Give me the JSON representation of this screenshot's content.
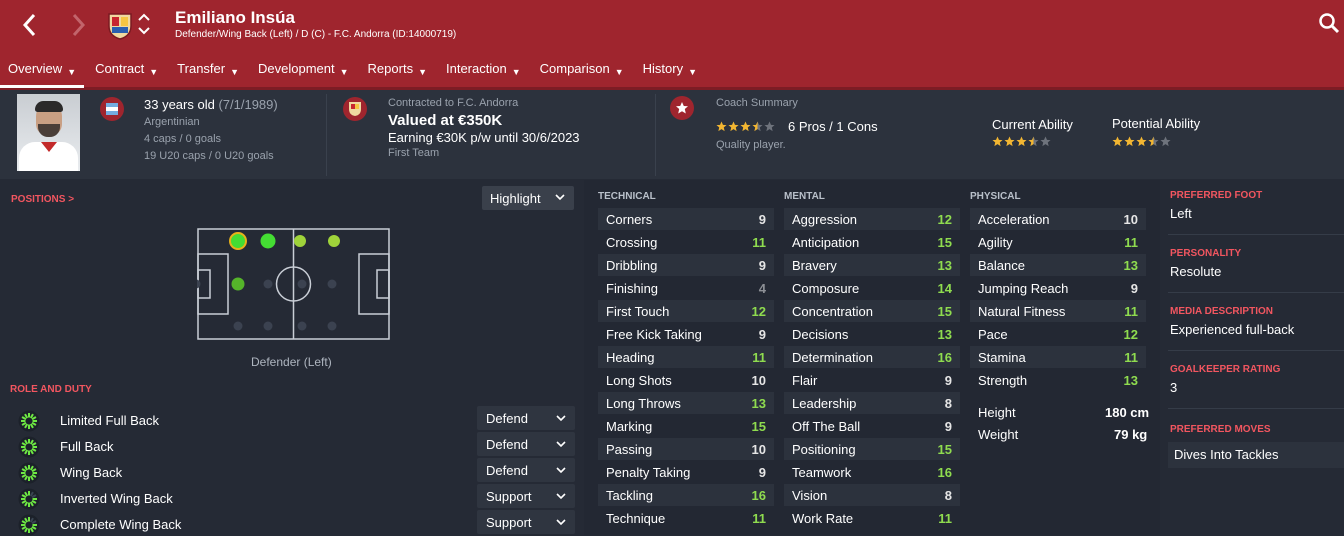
{
  "player": {
    "name": "Emiliano Insúa",
    "subtitle": "Defender/Wing Back (Left) / D (C) - F.C. Andorra (ID:14000719)"
  },
  "tabs": [
    {
      "label": "Overview"
    },
    {
      "label": "Contract"
    },
    {
      "label": "Transfer"
    },
    {
      "label": "Development"
    },
    {
      "label": "Reports"
    },
    {
      "label": "Interaction"
    },
    {
      "label": "Comparison"
    },
    {
      "label": "History"
    }
  ],
  "bio": {
    "age": "33 years old",
    "dob": "(7/1/1989)",
    "nationality": "Argentinian",
    "caps": "4 caps / 0 goals",
    "u20_caps": "19 U20 caps / 0 U20 goals"
  },
  "contract": {
    "contracted_to": "Contracted to F.C. Andorra",
    "value": "Valued at €350K",
    "earning": "Earning €30K p/w until 30/6/2023",
    "squad": "First Team"
  },
  "coach": {
    "title": "Coach Summary",
    "pros_cons": "6 Pros / 1 Cons",
    "stars": 3.5,
    "summary": "Quality player.",
    "current_ability_label": "Current Ability",
    "current_ability_stars": 3.5,
    "potential_ability_label": "Potential Ability",
    "potential_ability_stars": 3.5
  },
  "positions": {
    "title": "POSITIONS",
    "arrow": ">",
    "highlight_label": "Highlight",
    "position_label": "Defender (Left)"
  },
  "role_and_duty": {
    "title": "ROLE AND DUTY",
    "roles": [
      {
        "name": "Limited Full Back",
        "duty": "Defend"
      },
      {
        "name": "Full Back",
        "duty": "Defend"
      },
      {
        "name": "Wing Back",
        "duty": "Defend"
      },
      {
        "name": "Inverted Wing Back",
        "duty": "Support"
      },
      {
        "name": "Complete Wing Back",
        "duty": "Support"
      }
    ]
  },
  "technical": {
    "title": "TECHNICAL",
    "attrs": [
      {
        "name": "Corners",
        "value": "9"
      },
      {
        "name": "Crossing",
        "value": "11"
      },
      {
        "name": "Dribbling",
        "value": "9"
      },
      {
        "name": "Finishing",
        "value": "4"
      },
      {
        "name": "First Touch",
        "value": "12"
      },
      {
        "name": "Free Kick Taking",
        "value": "9"
      },
      {
        "name": "Heading",
        "value": "11"
      },
      {
        "name": "Long Shots",
        "value": "10"
      },
      {
        "name": "Long Throws",
        "value": "13"
      },
      {
        "name": "Marking",
        "value": "15"
      },
      {
        "name": "Passing",
        "value": "10"
      },
      {
        "name": "Penalty Taking",
        "value": "9"
      },
      {
        "name": "Tackling",
        "value": "16"
      },
      {
        "name": "Technique",
        "value": "11"
      }
    ]
  },
  "mental": {
    "title": "MENTAL",
    "attrs": [
      {
        "name": "Aggression",
        "value": "12"
      },
      {
        "name": "Anticipation",
        "value": "15"
      },
      {
        "name": "Bravery",
        "value": "13"
      },
      {
        "name": "Composure",
        "value": "14"
      },
      {
        "name": "Concentration",
        "value": "15"
      },
      {
        "name": "Decisions",
        "value": "13"
      },
      {
        "name": "Determination",
        "value": "16"
      },
      {
        "name": "Flair",
        "value": "9"
      },
      {
        "name": "Leadership",
        "value": "8"
      },
      {
        "name": "Off The Ball",
        "value": "9"
      },
      {
        "name": "Positioning",
        "value": "15"
      },
      {
        "name": "Teamwork",
        "value": "16"
      },
      {
        "name": "Vision",
        "value": "8"
      },
      {
        "name": "Work Rate",
        "value": "11"
      }
    ]
  },
  "physical": {
    "title": "PHYSICAL",
    "attrs": [
      {
        "name": "Acceleration",
        "value": "10"
      },
      {
        "name": "Agility",
        "value": "11"
      },
      {
        "name": "Balance",
        "value": "13"
      },
      {
        "name": "Jumping Reach",
        "value": "9"
      },
      {
        "name": "Natural Fitness",
        "value": "11"
      },
      {
        "name": "Pace",
        "value": "12"
      },
      {
        "name": "Stamina",
        "value": "11"
      },
      {
        "name": "Strength",
        "value": "13"
      }
    ],
    "height_label": "Height",
    "height": "180 cm",
    "weight_label": "Weight",
    "weight": "79 kg"
  },
  "sidebar": {
    "preferred_foot_label": "PREFERRED FOOT",
    "preferred_foot": "Left",
    "personality_label": "PERSONALITY",
    "personality": "Resolute",
    "media_label": "MEDIA DESCRIPTION",
    "media": "Experienced full-back",
    "gk_label": "GOALKEEPER RATING",
    "gk": "3",
    "moves_label": "PREFERRED MOVES",
    "moves": "Dives Into Tackles"
  },
  "colors": {
    "header_red": "#9f252e",
    "accent_red": "#f25660",
    "green": "#8fdc4f",
    "star": "#f2b632"
  }
}
